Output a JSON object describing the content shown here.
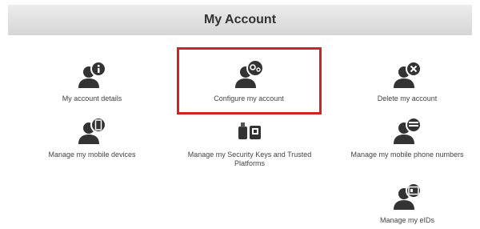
{
  "header": {
    "title": "My Account"
  },
  "tiles": [
    {
      "label": "My account details",
      "icon": "info-user-icon"
    },
    {
      "label": "Configure my account",
      "icon": "gear-user-icon"
    },
    {
      "label": "Delete my account",
      "icon": "delete-user-icon"
    },
    {
      "label": "Manage my mobile devices",
      "icon": "mobile-user-icon"
    },
    {
      "label": "Manage my Security Keys and Trusted Platforms",
      "icon": "security-key-icon"
    },
    {
      "label": "Manage my mobile phone numbers",
      "icon": "phone-number-user-icon"
    },
    {
      "label": "Manage my eIDs",
      "icon": "eid-user-icon"
    }
  ],
  "colors": {
    "highlight": "#d42121",
    "icon": "#333333"
  }
}
